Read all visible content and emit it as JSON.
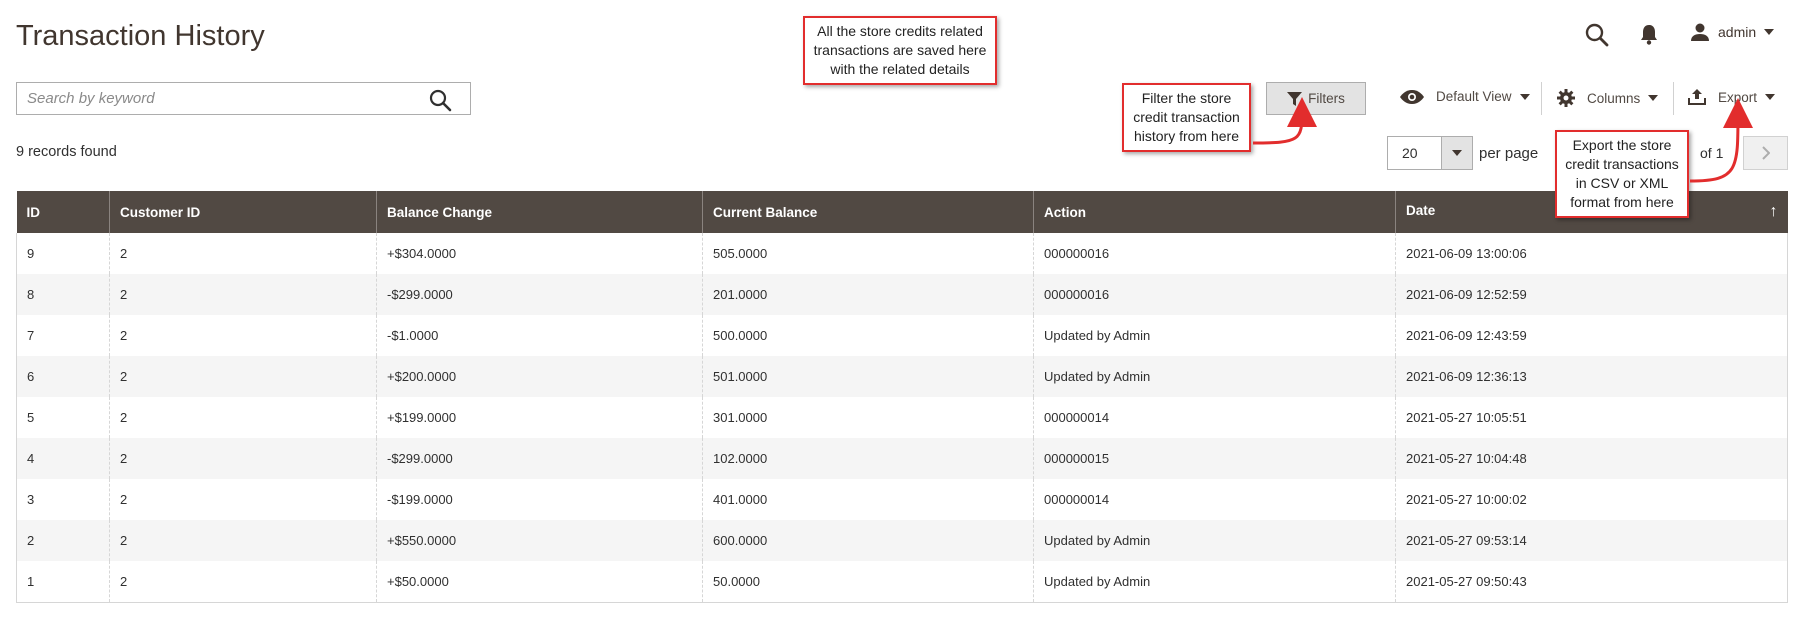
{
  "page": {
    "title": "Transaction History"
  },
  "search": {
    "placeholder": "Search by keyword"
  },
  "records_found": "9 records found",
  "header": {
    "user": "admin"
  },
  "toolbar": {
    "filters_label": "Filters",
    "view_label": "Default View",
    "columns_label": "Columns",
    "export_label": "Export"
  },
  "pager": {
    "per_page_value": "20",
    "per_page_label": "per page",
    "of_pages": "of 1"
  },
  "callouts": {
    "history": "All the store credits related transactions are saved here with the related details",
    "filter": "Filter the store credit transaction history from here",
    "export": "Export the store credit transactions in CSV or XML format from here"
  },
  "table": {
    "columns": [
      "ID",
      "Customer ID",
      "Balance Change",
      "Current Balance",
      "Action",
      "Date"
    ],
    "sort_indicator": "↑",
    "rows": [
      {
        "id": "9",
        "customer_id": "2",
        "balance_change": "+$304.0000",
        "current_balance": "505.0000",
        "action": "000000016",
        "date": "2021-06-09 13:00:06"
      },
      {
        "id": "8",
        "customer_id": "2",
        "balance_change": "-$299.0000",
        "current_balance": "201.0000",
        "action": "000000016",
        "date": "2021-06-09 12:52:59"
      },
      {
        "id": "7",
        "customer_id": "2",
        "balance_change": "-$1.0000",
        "current_balance": "500.0000",
        "action": "Updated by Admin",
        "date": "2021-06-09 12:43:59"
      },
      {
        "id": "6",
        "customer_id": "2",
        "balance_change": "+$200.0000",
        "current_balance": "501.0000",
        "action": "Updated by Admin",
        "date": "2021-06-09 12:36:13"
      },
      {
        "id": "5",
        "customer_id": "2",
        "balance_change": "+$199.0000",
        "current_balance": "301.0000",
        "action": "000000014",
        "date": "2021-05-27 10:05:51"
      },
      {
        "id": "4",
        "customer_id": "2",
        "balance_change": "-$299.0000",
        "current_balance": "102.0000",
        "action": "000000015",
        "date": "2021-05-27 10:04:48"
      },
      {
        "id": "3",
        "customer_id": "2",
        "balance_change": "-$199.0000",
        "current_balance": "401.0000",
        "action": "000000014",
        "date": "2021-05-27 10:00:02"
      },
      {
        "id": "2",
        "customer_id": "2",
        "balance_change": "+$550.0000",
        "current_balance": "600.0000",
        "action": "Updated by Admin",
        "date": "2021-05-27 09:53:14"
      },
      {
        "id": "1",
        "customer_id": "2",
        "balance_change": "+$50.0000",
        "current_balance": "50.0000",
        "action": "Updated by Admin",
        "date": "2021-05-27 09:50:43"
      }
    ]
  },
  "colors": {
    "header_bg": "#514943",
    "positive": "#185b00",
    "negative": "#e22626",
    "callout_border": "#e22d2d"
  }
}
